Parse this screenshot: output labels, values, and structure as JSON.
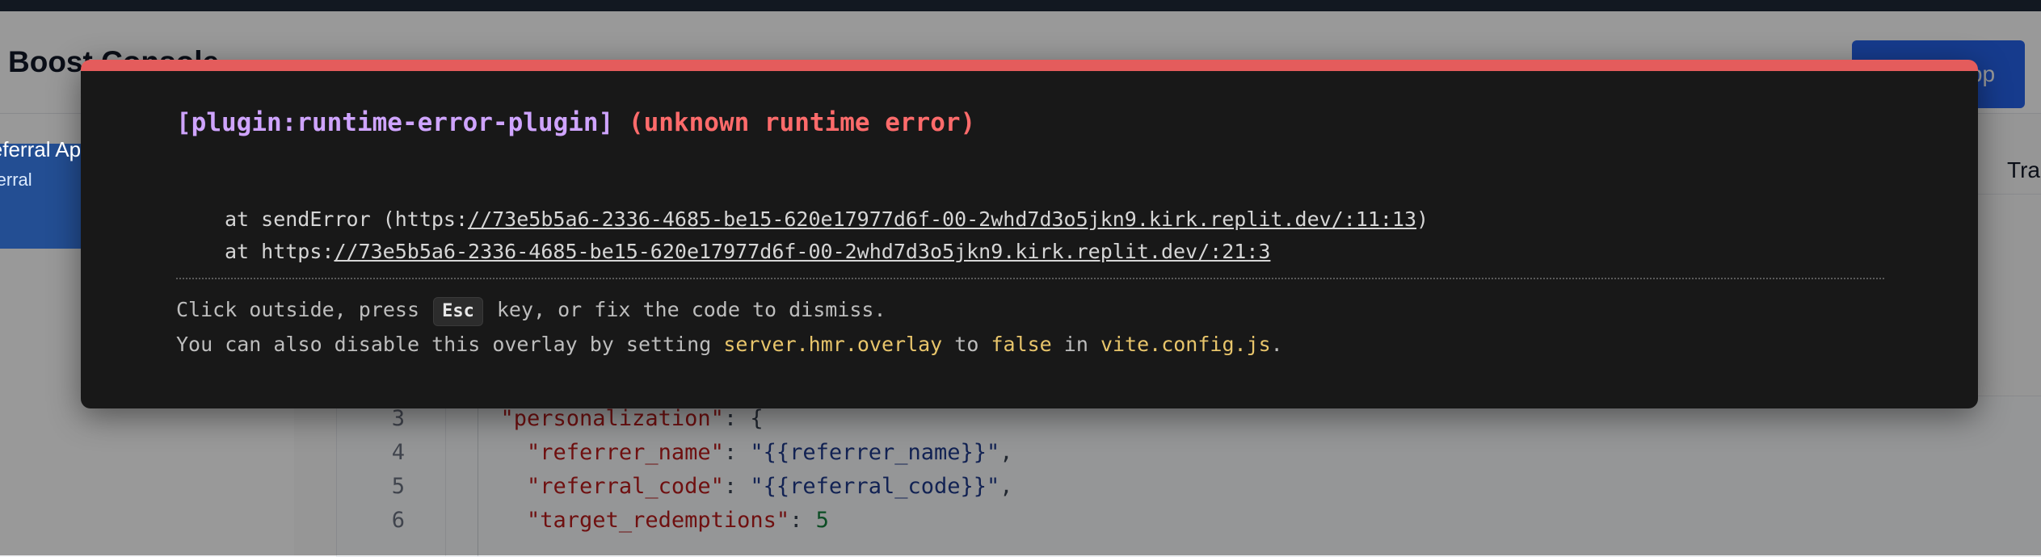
{
  "app": {
    "title": "Boost Console",
    "header_button": "Create App",
    "tab_partial": "Tra"
  },
  "sidebar": {
    "active_item": {
      "title": "Referral Ap",
      "subtitle": "referral"
    }
  },
  "code_editor": {
    "lines": [
      {
        "n": "3",
        "indent": "  ",
        "key": "\"personalization\"",
        "sep": ": ",
        "value": "{",
        "value_type": "punct",
        "trail": ""
      },
      {
        "n": "4",
        "indent": "    ",
        "key": "\"referrer_name\"",
        "sep": ": ",
        "value": "\"{{referrer_name}}\"",
        "value_type": "string",
        "trail": ","
      },
      {
        "n": "5",
        "indent": "    ",
        "key": "\"referral_code\"",
        "sep": ": ",
        "value": "\"{{referral_code}}\"",
        "value_type": "string",
        "trail": ","
      },
      {
        "n": "6",
        "indent": "    ",
        "key": "\"target_redemptions\"",
        "sep": ": ",
        "value": "5",
        "value_type": "number",
        "trail": ""
      }
    ]
  },
  "error_overlay": {
    "plugin": "[plugin:runtime-error-plugin]",
    "message": "(unknown runtime error)",
    "stack": [
      {
        "prefix": "at sendError (https:",
        "link": "//73e5b5a6-2336-4685-be15-620e17977d6f-00-2whd7d3o5jkn9.kirk.replit.dev/:11:13",
        "suffix": ")"
      },
      {
        "prefix": "at https:",
        "link": "//73e5b5a6-2336-4685-be15-620e17977d6f-00-2whd7d3o5jkn9.kirk.replit.dev/:21:3",
        "suffix": ""
      }
    ],
    "tip1": {
      "before": "Click outside, press ",
      "key": "Esc",
      "after": " key, or fix the code to dismiss."
    },
    "tip2": {
      "before": "You can also disable this overlay by setting ",
      "setting": "server.hmr.overlay",
      "middle": " to ",
      "value": "false",
      "in": " in ",
      "file": "vite.config.js",
      "end": "."
    }
  },
  "colors": {
    "accent_bar": "#e45c5c",
    "plugin_text": "#cfa4ff",
    "error_text": "#ff6b6b",
    "code_highlight": "#e8c56b"
  }
}
